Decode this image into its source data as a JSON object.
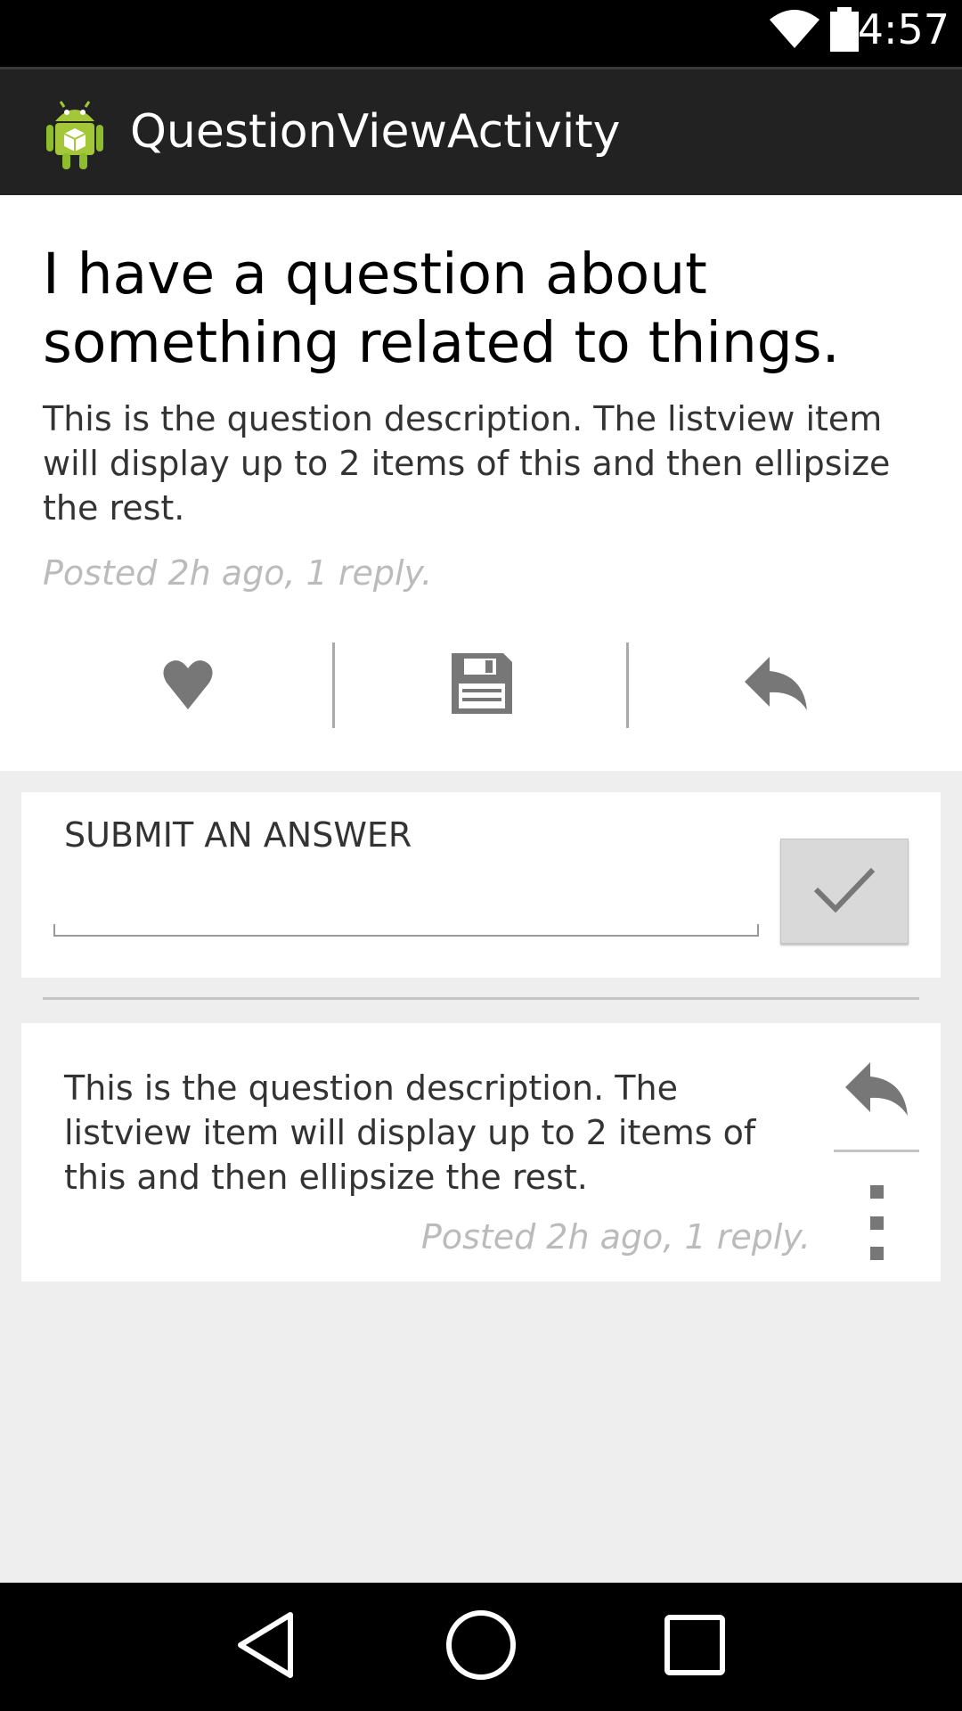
{
  "status_bar": {
    "time": "4:57",
    "wifi_icon": "wifi-icon",
    "battery_icon": "battery-icon"
  },
  "action_bar": {
    "app_icon": "android-icon",
    "title": "QuestionViewActivity"
  },
  "question": {
    "title": "I have a question about something related to things.",
    "description": "This is the question description. The listview item will display up to 2 items of this and then ellipsize the rest.",
    "meta": "Posted 2h ago, 1 reply.",
    "actions": [
      {
        "icon": "heart-icon"
      },
      {
        "icon": "save-icon"
      },
      {
        "icon": "reply-icon"
      }
    ]
  },
  "answer_form": {
    "label": "SUBMIT AN ANSWER",
    "value": "",
    "submit_icon": "checkmark-icon"
  },
  "replies": [
    {
      "text": "This is the question description. The listview item will display up to 2 items of this and then ellipsize the rest.",
      "meta": "Posted 2h ago, 1 reply.",
      "reply_icon": "reply-icon",
      "overflow_icon": "overflow-menu-icon"
    }
  ],
  "nav_bar": {
    "back_icon": "back-icon",
    "home_icon": "home-icon",
    "recents_icon": "recents-icon"
  },
  "colors": {
    "background": "#eeeeee",
    "action_bar": "#222222",
    "meta_text": "#bbbbbb",
    "icon_gray": "#777777"
  }
}
